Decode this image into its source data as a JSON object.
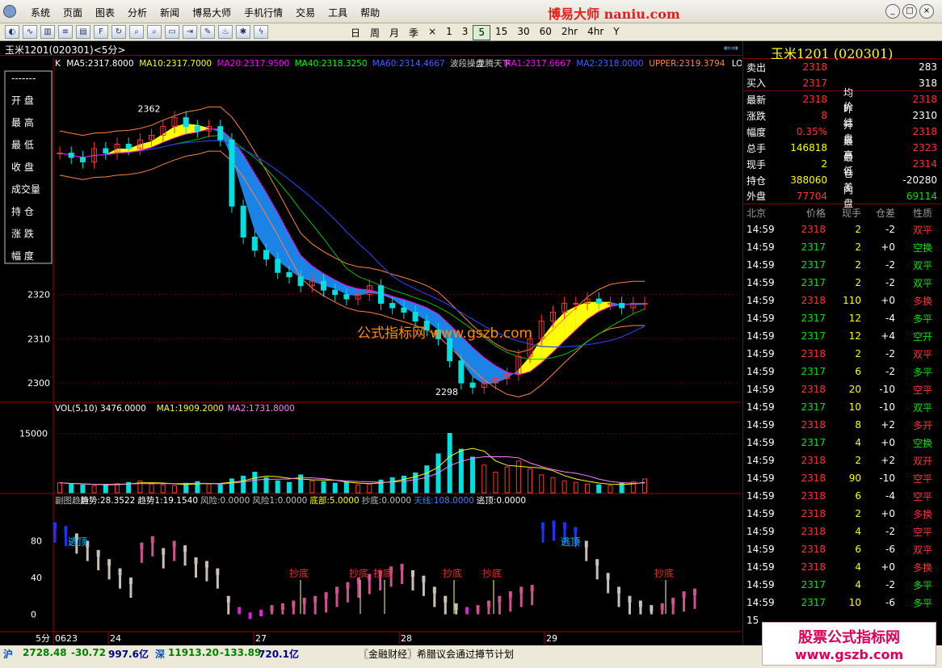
{
  "menu": {
    "items": [
      "系统",
      "页面",
      "图表",
      "分析",
      "新闻",
      "博易大师",
      "手机行情",
      "交易",
      "工具",
      "帮助"
    ],
    "brand": "博易大师 naniu.com"
  },
  "toolbar": {
    "periods": [
      "日",
      "周",
      "月",
      "季",
      "×",
      "1",
      "3",
      "5",
      "15",
      "30",
      "60",
      "2hr",
      "4hr",
      "Y"
    ],
    "active_period": "5"
  },
  "header": {
    "title": "玉米1201(020301)<5分>"
  },
  "main_chart": {
    "legend": [
      {
        "text": "K",
        "color": "#ffffff"
      },
      {
        "text": "MA5:2317.8000",
        "color": "#ffffff"
      },
      {
        "text": "MA10:2317.7000",
        "color": "#ffff00"
      },
      {
        "text": "MA20:2317.9500",
        "color": "#ff00ff"
      },
      {
        "text": "MA40:2318.3250",
        "color": "#00ff00"
      },
      {
        "text": "MA60:2314.4667",
        "color": "#4060ff"
      },
      {
        "text": "波段操盘",
        "color": "#cccccc"
      },
      {
        "text": "龙腾天下",
        "color": "#cccccc"
      },
      {
        "text": "MA1:2317.6667",
        "color": "#ff00ff"
      },
      {
        "text": "MA2:2318.0000",
        "color": "#4060ff"
      },
      {
        "text": "UPPER:2319.3794",
        "color": "#ff8040"
      },
      {
        "text": "LO",
        "color": "#ffffff"
      }
    ],
    "side_labels": [
      "-------",
      "开 盘",
      "最 高",
      "最 低",
      "收 盘",
      "成交量",
      "持 仓",
      "涨 跌",
      "幅 度"
    ],
    "high_label": "2362",
    "low_label": "2298",
    "watermark": "公式指标网 www.gszb.com"
  },
  "volume_chart": {
    "legend": [
      {
        "text": "VOL(5,10) 3476.0000",
        "color": "#ffffff"
      },
      {
        "text": "MA1:1909.2000",
        "color": "#ffff00"
      },
      {
        "text": "MA2:1731.8000",
        "color": "#ff80ff"
      }
    ],
    "y_tick": "15000"
  },
  "sub_chart": {
    "legend": [
      {
        "text": "副图趋势",
        "color": "#c0c0c0"
      },
      {
        "text": "趋势:28.3522",
        "color": "#ffffff"
      },
      {
        "text": "趋势1:19.1540",
        "color": "#ffffff"
      },
      {
        "text": "风险:0.0000",
        "color": "#c0c0c0"
      },
      {
        "text": "风险1:0.0000",
        "color": "#c0c0c0"
      },
      {
        "text": "底部:5.0000",
        "color": "#ffff00"
      },
      {
        "text": "抄底:0.0000",
        "color": "#c0c0c0"
      },
      {
        "text": "天线:108.0000",
        "color": "#4080ff"
      },
      {
        "text": "逃顶:0.0000",
        "color": "#ffffff"
      }
    ],
    "y_ticks": [
      "80",
      "40",
      "0"
    ],
    "escape_label": "逃顶",
    "buy_label": "抄底"
  },
  "x_axis": {
    "period_label": "5分",
    "ticks": [
      "0623",
      "24",
      "27",
      "28",
      "29"
    ]
  },
  "chart_data": [
    {
      "type": "candlestick",
      "y_ticks": [
        2320,
        2310,
        2300
      ],
      "ylim": [
        2296,
        2372
      ],
      "notes": "price trend from ~2352 down to ~2298 then recovering to ~2318",
      "close": [
        2352,
        2351,
        2350,
        2353,
        2352,
        2354,
        2353,
        2355,
        2356,
        2358,
        2360,
        2358,
        2357,
        2358,
        2355,
        2340,
        2333,
        2330,
        2328,
        2325,
        2324,
        2322,
        2323,
        2321,
        2320,
        2319,
        2320,
        2322,
        2318,
        2317,
        2316,
        2314,
        2312,
        2310,
        2305,
        2300,
        2299,
        2300,
        2301,
        2302,
        2306,
        2310,
        2314,
        2316,
        2318,
        2318,
        2319,
        2318,
        2318,
        2317,
        2318,
        2318
      ]
    },
    {
      "type": "bar",
      "name": "VOL",
      "ylim": [
        0,
        20000
      ],
      "values": [
        2500,
        2200,
        2000,
        1800,
        2100,
        2300,
        2600,
        3000,
        2200,
        2000,
        1800,
        2400,
        2800,
        2200,
        2000,
        3500,
        4200,
        5200,
        3800,
        3000,
        2600,
        4500,
        3000,
        2800,
        2400,
        2600,
        2000,
        2200,
        3200,
        3800,
        4200,
        5000,
        6800,
        9800,
        15000,
        11000,
        9000,
        7000,
        5200,
        6500,
        8000,
        6000,
        4500,
        3800,
        3000,
        2600,
        2200,
        2000,
        1800,
        2400,
        2800,
        3476
      ]
    },
    {
      "type": "bar",
      "name": "趋势",
      "ylim": [
        -10,
        120
      ],
      "values": [
        100,
        96,
        88,
        80,
        70,
        60,
        50,
        40,
        78,
        85,
        72,
        80,
        75,
        62,
        58,
        50,
        20,
        8,
        2,
        5,
        10,
        12,
        15,
        18,
        20,
        24,
        30,
        35,
        40,
        44,
        48,
        52,
        55,
        48,
        42,
        30,
        20,
        12,
        8,
        10,
        15,
        20,
        25,
        30,
        32,
        100,
        102,
        100,
        95,
        80,
        60,
        45,
        30,
        20,
        15,
        10,
        12,
        18,
        25,
        28
      ]
    }
  ],
  "right_panel": {
    "title": "玉米1201 (020301)",
    "sell": {
      "label": "卖出",
      "price": "2318",
      "vol": "283"
    },
    "buy": {
      "label": "买入",
      "price": "2317",
      "vol": "318"
    },
    "stats": [
      {
        "k1": "最新",
        "v1": "2318",
        "c1": "#ff3232",
        "k2": "均价",
        "v2": "2318",
        "c2": "#ff3232"
      },
      {
        "k1": "涨跌",
        "v1": "8",
        "c1": "#ff3232",
        "k2": "昨结",
        "v2": "2310",
        "c2": "#ffffff"
      },
      {
        "k1": "幅度",
        "v1": "0.35%",
        "c1": "#ff3232",
        "k2": "开盘",
        "v2": "2318",
        "c2": "#ff3232"
      },
      {
        "k1": "总手",
        "v1": "146818",
        "c1": "#ffff00",
        "k2": "最高",
        "v2": "2323",
        "c2": "#ff3232"
      },
      {
        "k1": "现手",
        "v1": "2",
        "c1": "#ffff00",
        "k2": "最低",
        "v2": "2314",
        "c2": "#ff3232"
      },
      {
        "k1": "持仓",
        "v1": "388060",
        "c1": "#ffff00",
        "k2": "仓差",
        "v2": "-20280",
        "c2": "#ffffff"
      },
      {
        "k1": "外盘",
        "v1": "77704",
        "c1": "#ff3232",
        "k2": "内盘",
        "v2": "69114",
        "c2": "#00e600"
      }
    ],
    "ticks_header": [
      "北京",
      "价格",
      "现手",
      "仓差",
      "性质"
    ],
    "ticks": [
      {
        "t": "14:59",
        "p": "2318",
        "pc": "#ff3232",
        "v": "2",
        "d": "-2",
        "k": "双平",
        "kc": "#ff3232"
      },
      {
        "t": "14:59",
        "p": "2317",
        "pc": "#00e600",
        "v": "2",
        "d": "+0",
        "k": "空换",
        "kc": "#00e600"
      },
      {
        "t": "14:59",
        "p": "2317",
        "pc": "#00e600",
        "v": "2",
        "d": "-2",
        "k": "双平",
        "kc": "#00e600"
      },
      {
        "t": "14:59",
        "p": "2317",
        "pc": "#00e600",
        "v": "2",
        "d": "-2",
        "k": "双平",
        "kc": "#00e600"
      },
      {
        "t": "14:59",
        "p": "2318",
        "pc": "#ff3232",
        "v": "110",
        "d": "+0",
        "k": "多换",
        "kc": "#ff3232"
      },
      {
        "t": "14:59",
        "p": "2317",
        "pc": "#00e600",
        "v": "12",
        "d": "-4",
        "k": "多平",
        "kc": "#00e600"
      },
      {
        "t": "14:59",
        "p": "2317",
        "pc": "#00e600",
        "v": "12",
        "d": "+4",
        "k": "空开",
        "kc": "#00e600"
      },
      {
        "t": "14:59",
        "p": "2318",
        "pc": "#ff3232",
        "v": "2",
        "d": "-2",
        "k": "双平",
        "kc": "#ff3232"
      },
      {
        "t": "14:59",
        "p": "2317",
        "pc": "#00e600",
        "v": "6",
        "d": "-2",
        "k": "多平",
        "kc": "#00e600"
      },
      {
        "t": "14:59",
        "p": "2318",
        "pc": "#ff3232",
        "v": "20",
        "d": "-10",
        "k": "空平",
        "kc": "#ff3232"
      },
      {
        "t": "14:59",
        "p": "2317",
        "pc": "#00e600",
        "v": "10",
        "d": "-10",
        "k": "双平",
        "kc": "#00e600"
      },
      {
        "t": "14:59",
        "p": "2318",
        "pc": "#ff3232",
        "v": "8",
        "d": "+2",
        "k": "多开",
        "kc": "#ff3232"
      },
      {
        "t": "14:59",
        "p": "2317",
        "pc": "#00e600",
        "v": "4",
        "d": "+0",
        "k": "空换",
        "kc": "#00e600"
      },
      {
        "t": "14:59",
        "p": "2318",
        "pc": "#ff3232",
        "v": "2",
        "d": "+2",
        "k": "双开",
        "kc": "#ff3232"
      },
      {
        "t": "14:59",
        "p": "2318",
        "pc": "#ff3232",
        "v": "90",
        "d": "-10",
        "k": "空平",
        "kc": "#ff3232"
      },
      {
        "t": "14:59",
        "p": "2318",
        "pc": "#ff3232",
        "v": "6",
        "d": "-4",
        "k": "空平",
        "kc": "#ff3232"
      },
      {
        "t": "14:59",
        "p": "2318",
        "pc": "#ff3232",
        "v": "2",
        "d": "+0",
        "k": "多换",
        "kc": "#ff3232"
      },
      {
        "t": "14:59",
        "p": "2318",
        "pc": "#ff3232",
        "v": "4",
        "d": "-2",
        "k": "空平",
        "kc": "#ff3232"
      },
      {
        "t": "14:59",
        "p": "2318",
        "pc": "#ff3232",
        "v": "6",
        "d": "-6",
        "k": "双平",
        "kc": "#ff3232"
      },
      {
        "t": "14:59",
        "p": "2318",
        "pc": "#ff3232",
        "v": "4",
        "d": "+0",
        "k": "多换",
        "kc": "#ff3232"
      },
      {
        "t": "14:59",
        "p": "2317",
        "pc": "#00e600",
        "v": "4",
        "d": "-2",
        "k": "多平",
        "kc": "#00e600"
      },
      {
        "t": "14:59",
        "p": "2317",
        "pc": "#00e600",
        "v": "10",
        "d": "-6",
        "k": "多平",
        "kc": "#00e600"
      },
      {
        "t": "15",
        "p": "",
        "pc": "#ff3232",
        "v": "",
        "d": "",
        "k": "",
        "kc": "#ff3232"
      }
    ]
  },
  "status": {
    "sh_label": "沪",
    "sh_index": "2728.48",
    "sh_change": "-30.72",
    "sh_amount": "997.6亿",
    "sz_label": "深",
    "sz_index": "11913.20",
    "sz_change": "-133.89",
    "sz_amount": "720.1亿",
    "news": "〖金融财经〗希腊议会通过撙节计划"
  },
  "ad": {
    "line1": "股票公式指标网",
    "line2": "www.gszb.com"
  }
}
